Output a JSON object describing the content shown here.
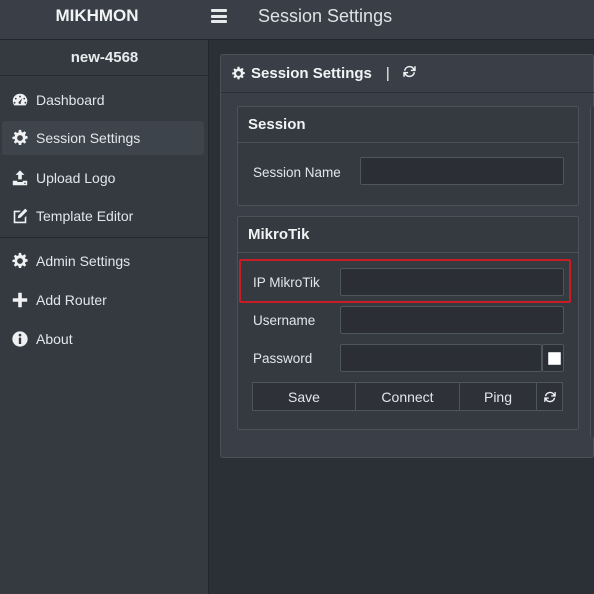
{
  "app": {
    "brand": "MIKHMON",
    "page_title": "Session Settings"
  },
  "sidebar": {
    "session_name": "new-4568",
    "items": [
      {
        "label": "Dashboard",
        "icon": "dashboard-icon"
      },
      {
        "label": "Session Settings",
        "icon": "gear-icon",
        "active": true
      },
      {
        "label": "Upload Logo",
        "icon": "upload-icon"
      },
      {
        "label": "Template Editor",
        "icon": "edit-icon"
      },
      {
        "label": "Admin Settings",
        "icon": "gear-icon"
      },
      {
        "label": "Add Router",
        "icon": "plus-icon"
      },
      {
        "label": "About",
        "icon": "info-icon"
      }
    ]
  },
  "panel": {
    "title": "Session Settings",
    "separator": "|",
    "session_card": {
      "title": "Session",
      "session_name_label": "Session Name",
      "session_name_value": ""
    },
    "mikrotik_card": {
      "title": "MikroTik",
      "ip_label": "IP MikroTik",
      "ip_value": "",
      "username_label": "Username",
      "username_value": "",
      "password_label": "Password",
      "password_value": "",
      "save_label": "Save",
      "connect_label": "Connect",
      "ping_label": "Ping"
    }
  },
  "colors": {
    "highlight": "#c81d25",
    "background": "#2b3037"
  }
}
